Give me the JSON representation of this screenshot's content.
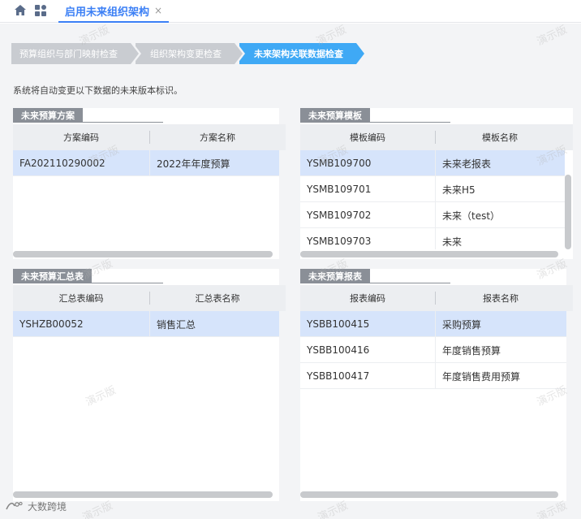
{
  "tab": {
    "label": "启用未来组织架构",
    "close": "×"
  },
  "steps": [
    {
      "label": "预算组织与部门映射检查",
      "state": "done"
    },
    {
      "label": "组织架构变更检查",
      "state": "done"
    },
    {
      "label": "未来架构关联数据检查",
      "state": "active"
    }
  ],
  "notice": "系统将自动变更以下数据的未来版本标识。",
  "panels": {
    "scheme": {
      "title": "未来预算方案",
      "columns": [
        "方案编码",
        "方案名称"
      ],
      "rows": [
        {
          "code": "FA202110290002",
          "name": "2022年年度预算",
          "selected": true
        }
      ]
    },
    "template": {
      "title": "未来预算模板",
      "columns": [
        "模板编码",
        "模板名称"
      ],
      "rows": [
        {
          "code": "YSMB109700",
          "name": "未来老报表",
          "selected": true
        },
        {
          "code": "YSMB109701",
          "name": "未来H5",
          "selected": false
        },
        {
          "code": "YSMB109702",
          "name": "未来（test）",
          "selected": false
        },
        {
          "code": "YSMB109703",
          "name": "未来",
          "selected": false
        }
      ]
    },
    "summary": {
      "title": "未来预算汇总表",
      "columns": [
        "汇总表编码",
        "汇总表名称"
      ],
      "rows": [
        {
          "code": "YSHZB00052",
          "name": "销售汇总",
          "selected": true
        }
      ]
    },
    "report": {
      "title": "未来预算报表",
      "columns": [
        "报表编码",
        "报表名称"
      ],
      "rows": [
        {
          "code": "YSBB100415",
          "name": "采购预算",
          "selected": true
        },
        {
          "code": "YSBB100416",
          "name": "年度销售预算",
          "selected": false
        },
        {
          "code": "YSBB100417",
          "name": "年度销售费用预算",
          "selected": false
        }
      ]
    }
  },
  "watermark": "演示版",
  "footer": {
    "brand": "大数跨境"
  },
  "colors": {
    "accent": "#3b7ff5",
    "step_active": "#3fa9f5",
    "step_done": "#c9ccd1",
    "selected_row": "#d6e4fb",
    "panel_title": "#8a8f97"
  },
  "icons": {
    "home": "home-icon",
    "apps": "apps-icon",
    "close": "close-icon"
  }
}
